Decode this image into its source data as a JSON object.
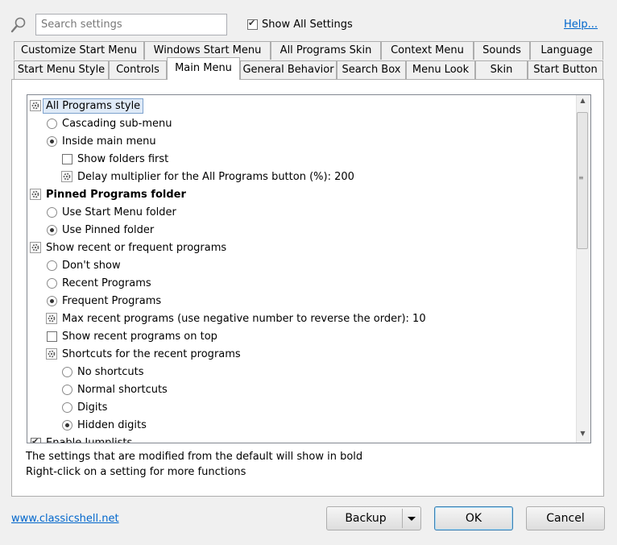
{
  "search": {
    "placeholder": "Search settings"
  },
  "show_all_settings": {
    "label": "Show All Settings",
    "checked": true
  },
  "help": {
    "label": "Help..."
  },
  "tabs": {
    "row1": [
      "Customize Start Menu",
      "Windows Start Menu",
      "All Programs Skin",
      "Context Menu",
      "Sounds",
      "Language"
    ],
    "row2": [
      "Start Menu Style",
      "Controls",
      "Main Menu",
      "General Behavior",
      "Search Box",
      "Menu Look",
      "Skin",
      "Start Button"
    ],
    "active": "Main Menu"
  },
  "tree": {
    "items": [
      {
        "label": "All Programs style",
        "kind": "group",
        "selected": true
      },
      {
        "label": "Cascading sub-menu",
        "kind": "radio",
        "checked": false
      },
      {
        "label": "Inside main menu",
        "kind": "radio",
        "checked": true
      },
      {
        "label": "Show folders first",
        "kind": "checkbox",
        "checked": false
      },
      {
        "label": "Delay multiplier for the All Programs button (%): 200",
        "kind": "setting"
      },
      {
        "label": "Pinned Programs folder",
        "kind": "group",
        "bold": true
      },
      {
        "label": "Use Start Menu folder",
        "kind": "radio",
        "checked": false
      },
      {
        "label": "Use Pinned folder",
        "kind": "radio",
        "checked": true
      },
      {
        "label": "Show recent or frequent programs",
        "kind": "group"
      },
      {
        "label": "Don't show",
        "kind": "radio",
        "checked": false
      },
      {
        "label": "Recent Programs",
        "kind": "radio",
        "checked": false
      },
      {
        "label": "Frequent Programs",
        "kind": "radio",
        "checked": true
      },
      {
        "label": "Max recent programs (use negative number to reverse the order): 10",
        "kind": "setting"
      },
      {
        "label": "Show recent programs on top",
        "kind": "checkbox",
        "checked": false
      },
      {
        "label": "Shortcuts for the recent programs",
        "kind": "setting"
      },
      {
        "label": "No shortcuts",
        "kind": "radio",
        "checked": false
      },
      {
        "label": "Normal shortcuts",
        "kind": "radio",
        "checked": false
      },
      {
        "label": "Digits",
        "kind": "radio",
        "checked": false
      },
      {
        "label": "Hidden digits",
        "kind": "radio",
        "checked": true
      },
      {
        "label": "Enable Jumplists",
        "kind": "checkbox",
        "checked": true
      }
    ]
  },
  "info": {
    "line1": "The settings that are modified from the default will show in bold",
    "line2": "Right-click on a setting for more functions"
  },
  "footer": {
    "website": "www.classicshell.net",
    "backup": "Backup",
    "ok": "OK",
    "cancel": "Cancel"
  }
}
